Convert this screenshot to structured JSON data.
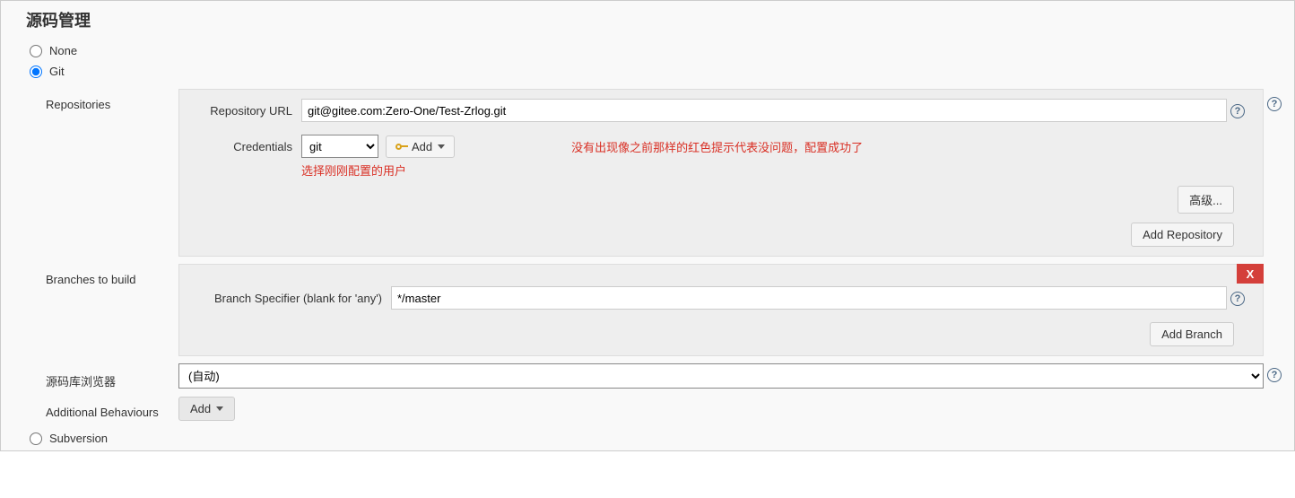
{
  "section_title": "源码管理",
  "scm_options": {
    "none_label": "None",
    "git_label": "Git",
    "subversion_label": "Subversion",
    "selected": "git"
  },
  "repositories": {
    "label": "Repositories",
    "repo_url_label": "Repository URL",
    "repo_url_value": "git@gitee.com:Zero-One/Test-Zrlog.git",
    "credentials_label": "Credentials",
    "credentials_value": "git",
    "add_button": "Add",
    "annotation_right": "没有出现像之前那样的红色提示代表没问题，配置成功了",
    "annotation_below": "选择刚刚配置的用户",
    "advanced_button": "高级...",
    "add_repo_button": "Add Repository"
  },
  "branches": {
    "label": "Branches to build",
    "specifier_label": "Branch Specifier (blank for 'any')",
    "specifier_value": "*/master",
    "add_branch_button": "Add Branch",
    "delete_label": "X"
  },
  "repo_browser": {
    "label": "源码库浏览器",
    "value": "(自动)"
  },
  "additional_behaviours": {
    "label": "Additional Behaviours",
    "add_button": "Add"
  },
  "help_glyph": "?"
}
